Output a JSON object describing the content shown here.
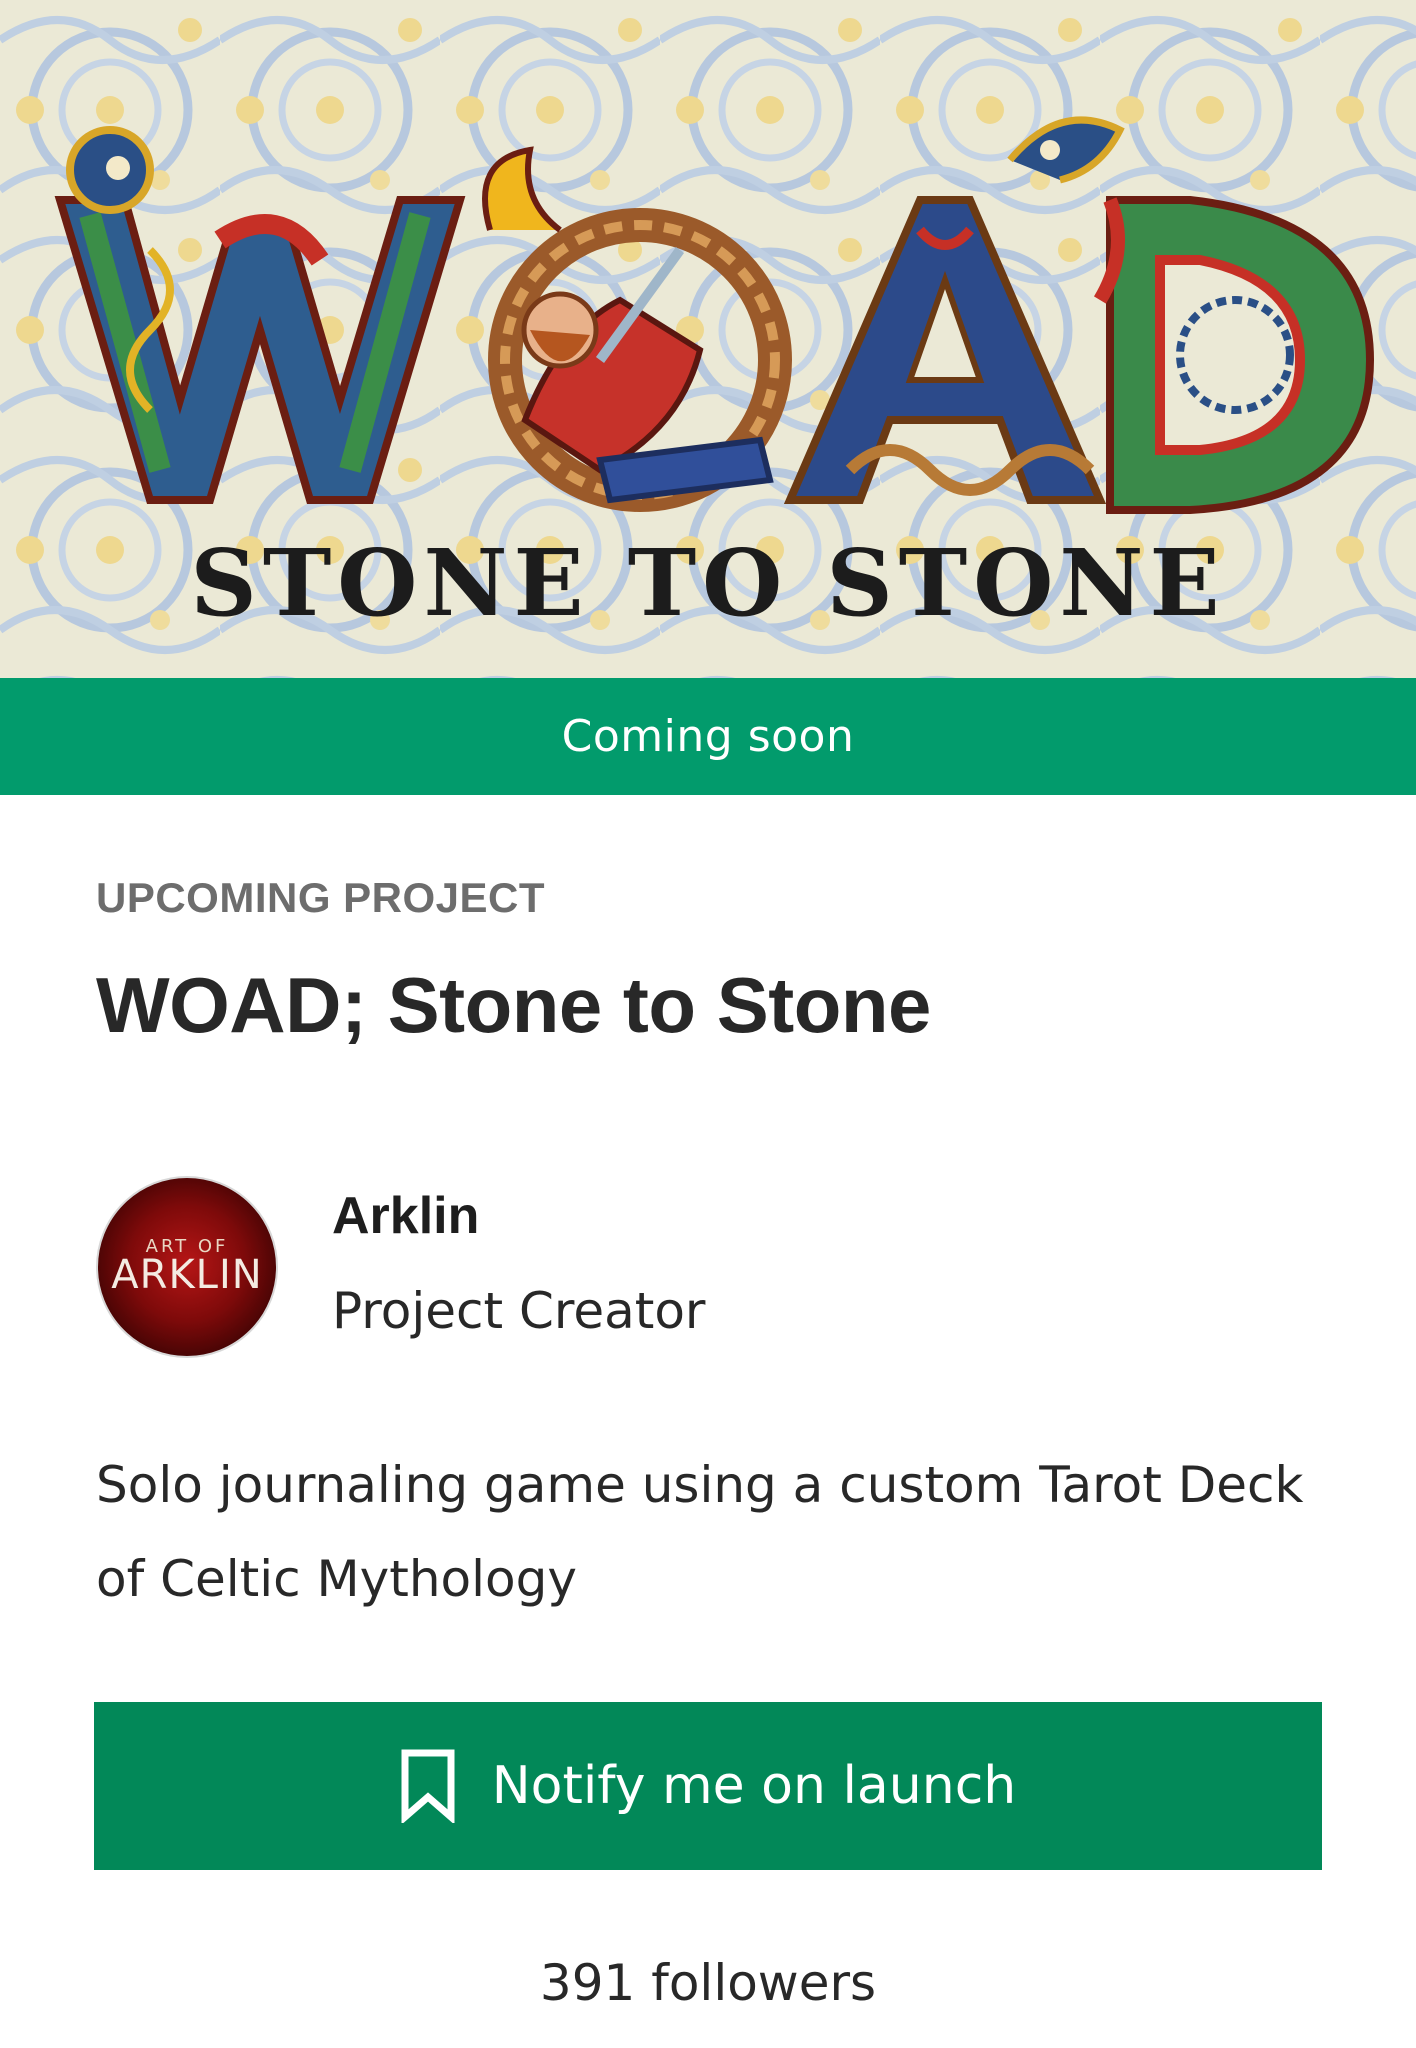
{
  "hero": {
    "logo_text": "WOAD",
    "subtitle_text": "STONE TO STONE"
  },
  "status": {
    "label": "Coming soon",
    "color": "#029b6c"
  },
  "project": {
    "eyebrow": "UPCOMING PROJECT",
    "title": "WOAD; Stone to Stone",
    "description": "Solo journaling game using a custom Tarot Deck of Celtic Mythology"
  },
  "creator": {
    "name": "Arklin",
    "role": "Project Creator",
    "avatar_text_top": "ART OF",
    "avatar_text_main": "ARKLIN"
  },
  "actions": {
    "notify_label": "Notify me on launch",
    "notify_icon": "bookmark-icon",
    "button_color": "#028858"
  },
  "stats": {
    "followers_label": "391 followers"
  }
}
